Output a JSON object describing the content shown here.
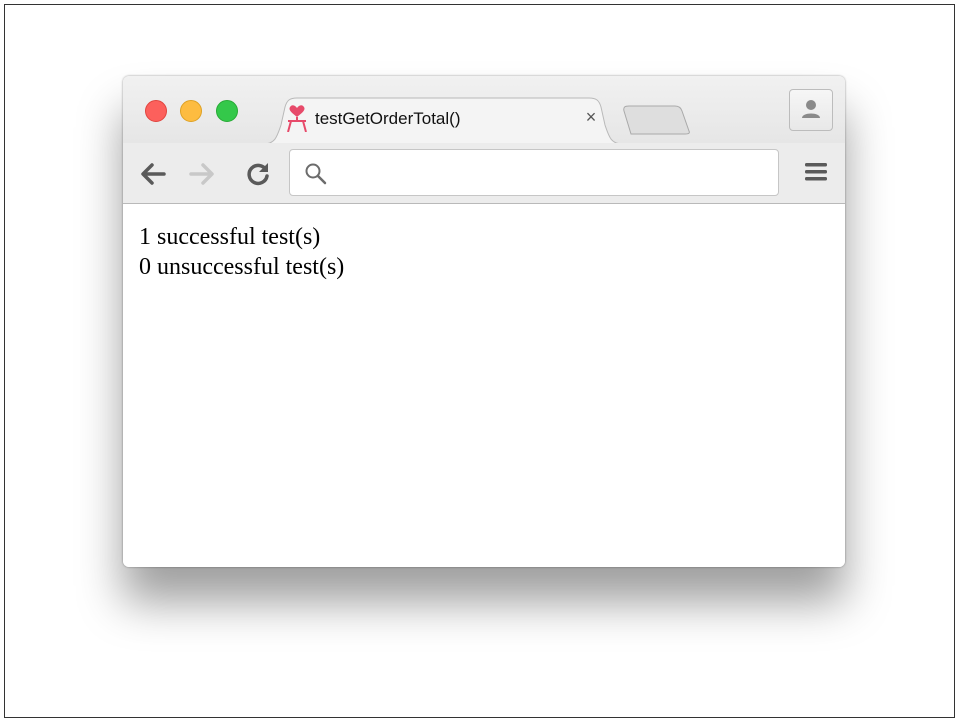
{
  "tab": {
    "title": "testGetOrderTotal()",
    "close_symbol": "×",
    "favicon": "chair-heart-icon"
  },
  "toolbar": {
    "back_icon": "back-arrow-icon",
    "forward_icon": "forward-arrow-icon",
    "reload_icon": "reload-icon",
    "menu_icon": "hamburger-menu-icon"
  },
  "address_bar": {
    "value": "",
    "placeholder": ""
  },
  "content": {
    "lines": [
      "1 successful test(s)",
      "0 unsuccessful test(s)"
    ]
  },
  "colors": {
    "close": "#fc605c",
    "minimize": "#fdbc40",
    "maximize": "#34c84a"
  }
}
